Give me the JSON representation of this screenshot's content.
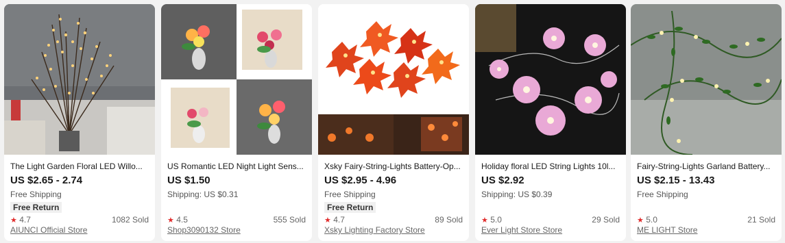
{
  "products": [
    {
      "title": "The Light Garden Floral LED Willo...",
      "price": "US $2.65 - 2.74",
      "shipping": "Free Shipping",
      "badge": "Free Return",
      "rating": "4.7",
      "sold": "1082 Sold",
      "store": "AIUNCI Official Store",
      "image_icon": "willow-branch-lamp-image"
    },
    {
      "title": "US Romantic LED Night Light Sens...",
      "price": "US $1.50",
      "shipping": "Shipping: US $0.31",
      "rating": "4.5",
      "sold": "555 Sold",
      "store": "Shop3090132 Store",
      "image_icon": "flower-night-light-image"
    },
    {
      "title": "Xsky Fairy-String-Lights Battery-Op...",
      "price": "US $2.95 - 4.96",
      "shipping": "Free Shipping",
      "badge": "Free Return",
      "rating": "4.7",
      "sold": "89 Sold",
      "store": "Xsky Lighting Factory Store",
      "image_icon": "maple-leaf-lights-image"
    },
    {
      "title": "Holiday floral LED String Lights 10l...",
      "price": "US $2.92",
      "shipping": "Shipping: US $0.39",
      "rating": "5.0",
      "sold": "29 Sold",
      "store": "Ever Light Store Store",
      "image_icon": "pink-flower-lights-image"
    },
    {
      "title": "Fairy-String-Lights Garland Battery...",
      "price": "US $2.15 - 13.43",
      "shipping": "Free Shipping",
      "rating": "5.0",
      "sold": "21 Sold",
      "store": "ME LIGHT Store",
      "image_icon": "vine-garland-lights-image"
    }
  ],
  "star_glyph": "★",
  "colors": {
    "star": "#e12d2d",
    "price": "#191919",
    "card_bg": "#ffffff",
    "page_bg": "#f2f2f2"
  }
}
